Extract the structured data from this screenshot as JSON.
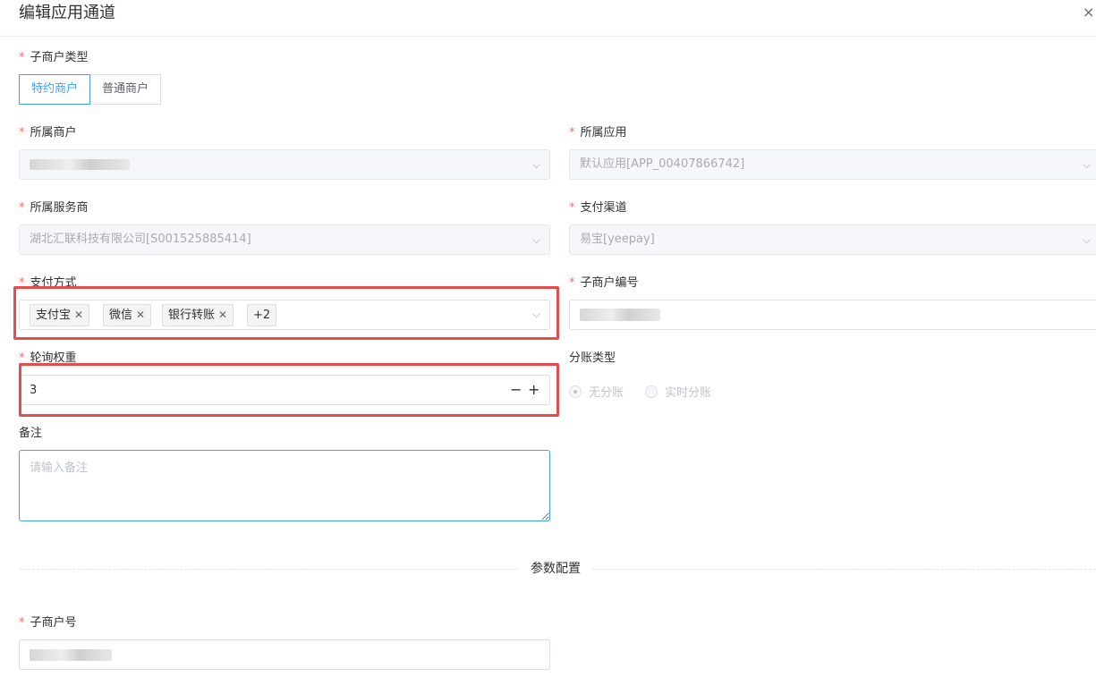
{
  "dialog": {
    "title": "编辑应用通道",
    "close_icon": "×"
  },
  "form": {
    "submerchant_type": {
      "label": "子商户类型",
      "options": [
        "特约商户",
        "普通商户"
      ],
      "selected": "特约商户"
    },
    "merchant": {
      "label": "所属商户"
    },
    "app": {
      "label": "所属应用",
      "value": "默认应用[APP_00407866742]"
    },
    "service_provider": {
      "label": "所属服务商",
      "value": "湖北汇联科技有限公司[S001525885414]"
    },
    "pay_channel": {
      "label": "支付渠道",
      "value": "易宝[yeepay]"
    },
    "pay_methods": {
      "label": "支付方式",
      "tags": [
        "支付宝",
        "微信",
        "银行转账"
      ],
      "more": "+2"
    },
    "submerchant_code": {
      "label": "子商户编号"
    },
    "poll_weight": {
      "label": "轮询权重",
      "value": "3",
      "minus": "−",
      "plus": "+"
    },
    "split_type": {
      "label": "分账类型",
      "options": [
        "无分账",
        "实时分账"
      ],
      "selected": "无分账"
    },
    "remark": {
      "label": "备注",
      "placeholder": "请输入备注"
    },
    "param_section": {
      "title": "参数配置"
    },
    "submerchant_no": {
      "label": "子商户号"
    }
  },
  "required_mark": "*",
  "chevron": "⌵"
}
